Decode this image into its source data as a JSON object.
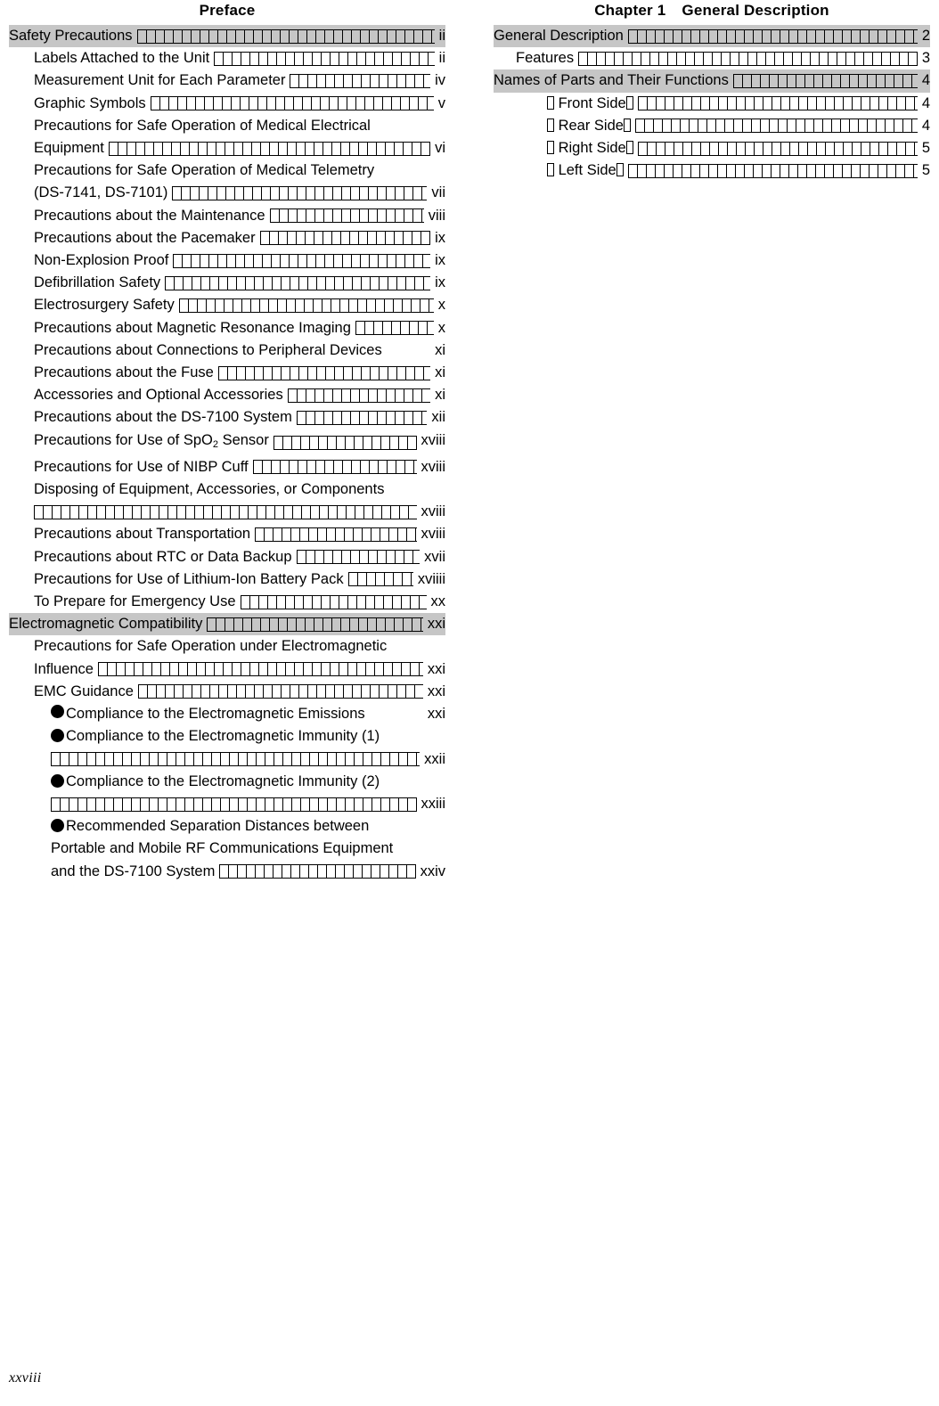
{
  "document": {
    "folio": "xxviii"
  },
  "left_column": {
    "title": "Preface",
    "entries": [
      {
        "level": 1,
        "highlight": true,
        "label": "Safety Precautions",
        "page": "ii",
        "wrapped": false,
        "bullet": false
      },
      {
        "level": 2,
        "highlight": false,
        "label": "Labels Attached to the Unit",
        "page": "ii",
        "wrapped": false,
        "bullet": false
      },
      {
        "level": 2,
        "highlight": false,
        "label": "Measurement Unit for Each Parameter",
        "page": "iv",
        "wrapped": false,
        "bullet": false
      },
      {
        "level": 2,
        "highlight": false,
        "label": "Graphic Symbols",
        "page": "v",
        "wrapped": false,
        "bullet": false
      },
      {
        "level": 2,
        "highlight": false,
        "label": "Precautions for Safe Operation of Medical Electrical",
        "label2": "Equipment",
        "page": "vi",
        "wrapped": true,
        "bullet": false
      },
      {
        "level": 2,
        "highlight": false,
        "label": "Precautions for Safe Operation of Medical Telemetry",
        "label2": "(DS-7141, DS-7101)",
        "page": "vii",
        "wrapped": true,
        "bullet": false
      },
      {
        "level": 2,
        "highlight": false,
        "label": "Precautions about the Maintenance",
        "page": "viii",
        "wrapped": false,
        "bullet": false
      },
      {
        "level": 2,
        "highlight": false,
        "label": "Precautions about the Pacemaker",
        "page": "ix",
        "wrapped": false,
        "bullet": false
      },
      {
        "level": 2,
        "highlight": false,
        "label": "Non-Explosion Proof",
        "page": "ix",
        "wrapped": false,
        "bullet": false
      },
      {
        "level": 2,
        "highlight": false,
        "label": "Defibrillation Safety",
        "page": "ix",
        "wrapped": false,
        "bullet": false
      },
      {
        "level": 2,
        "highlight": false,
        "label": "Electrosurgery Safety",
        "page": "x",
        "wrapped": false,
        "bullet": false
      },
      {
        "level": 2,
        "highlight": false,
        "label": "Precautions about Magnetic Resonance Imaging",
        "page": "x",
        "wrapped": false,
        "bullet": false
      },
      {
        "level": 2,
        "highlight": false,
        "label": "Precautions about Connections to Peripheral Devices",
        "page": "xi",
        "wrapped": false,
        "bullet": false,
        "noleader": true
      },
      {
        "level": 2,
        "highlight": false,
        "label": "Precautions about the Fuse",
        "page": "xi",
        "wrapped": false,
        "bullet": false
      },
      {
        "level": 2,
        "highlight": false,
        "label": "Accessories and Optional Accessories",
        "page": "xi",
        "wrapped": false,
        "bullet": false
      },
      {
        "level": 2,
        "highlight": false,
        "label": "Precautions about the DS-7100 System",
        "page": "xii",
        "wrapped": false,
        "bullet": false
      },
      {
        "level": 2,
        "highlight": false,
        "label": "Precautions for Use of SpO2 Sensor",
        "page": "xviii",
        "wrapped": false,
        "bullet": false,
        "sub": true
      },
      {
        "level": 2,
        "highlight": false,
        "label": "Precautions for Use of NIBP Cuff",
        "page": "xviii",
        "wrapped": false,
        "bullet": false
      },
      {
        "level": 2,
        "highlight": false,
        "label": "Disposing of Equipment, Accessories, or Components",
        "label2": "",
        "page": "xviii",
        "wrapped": true,
        "bullet": false
      },
      {
        "level": 2,
        "highlight": false,
        "label": "Precautions about Transportation",
        "page": "xviii",
        "wrapped": false,
        "bullet": false
      },
      {
        "level": 2,
        "highlight": false,
        "label": "Precautions about RTC or Data Backup",
        "page": "xvii",
        "wrapped": false,
        "bullet": false
      },
      {
        "level": 2,
        "highlight": false,
        "label": "Precautions for Use of Lithium-Ion Battery Pack",
        "page": "xviiii",
        "wrapped": false,
        "bullet": false
      },
      {
        "level": 2,
        "highlight": false,
        "label": "To Prepare for Emergency Use",
        "page": "xx",
        "wrapped": false,
        "bullet": false
      },
      {
        "level": 1,
        "highlight": true,
        "label": "Electromagnetic Compatibility",
        "page": "xxi",
        "wrapped": false,
        "bullet": false
      },
      {
        "level": 2,
        "highlight": false,
        "label": "Precautions for Safe Operation under Electromagnetic",
        "label2": "Influence",
        "page": "xxi",
        "wrapped": true,
        "bullet": false
      },
      {
        "level": 2,
        "highlight": false,
        "label": "EMC Guidance",
        "page": "xxi",
        "wrapped": false,
        "bullet": false
      },
      {
        "level": 3,
        "highlight": false,
        "label": "Compliance to the Electromagnetic Emissions",
        "page": "xxi",
        "wrapped": false,
        "bullet": true,
        "noleader": true
      },
      {
        "level": 3,
        "highlight": false,
        "label": "Compliance to the Electromagnetic Immunity (1)",
        "label2": "",
        "page": "xxii",
        "wrapped": true,
        "bullet": true
      },
      {
        "level": 3,
        "highlight": false,
        "label": "Compliance to the Electromagnetic Immunity (2)",
        "label2": "",
        "page": "xxiii",
        "wrapped": true,
        "bullet": true
      },
      {
        "level": 3,
        "highlight": false,
        "label": "Recommended Separation Distances between",
        "label_extra": "Portable and Mobile RF Communications Equipment",
        "label2": "and the DS-7100 System",
        "page": "xxiv",
        "wrapped": true,
        "bullet": true
      }
    ]
  },
  "right_column": {
    "title_chapter": "Chapter 1",
    "title_name": "General Description",
    "entries": [
      {
        "level": 1,
        "highlight": true,
        "label": "General Description",
        "page": "2",
        "bracket": false
      },
      {
        "level": 2,
        "highlight": false,
        "label": "Features",
        "page": "3",
        "bracket": false
      },
      {
        "level": 1,
        "highlight": true,
        "label": "Names of Parts and Their Functions",
        "page": "4",
        "bracket": false
      },
      {
        "level": 3,
        "highlight": false,
        "label": "Front Side",
        "page": "4",
        "bracket": true
      },
      {
        "level": 3,
        "highlight": false,
        "label": "Rear Side",
        "page": "4",
        "bracket": true
      },
      {
        "level": 3,
        "highlight": false,
        "label": "Right Side",
        "page": "5",
        "bracket": true
      },
      {
        "level": 3,
        "highlight": false,
        "label": "Left Side",
        "page": "5",
        "bracket": true
      }
    ]
  }
}
